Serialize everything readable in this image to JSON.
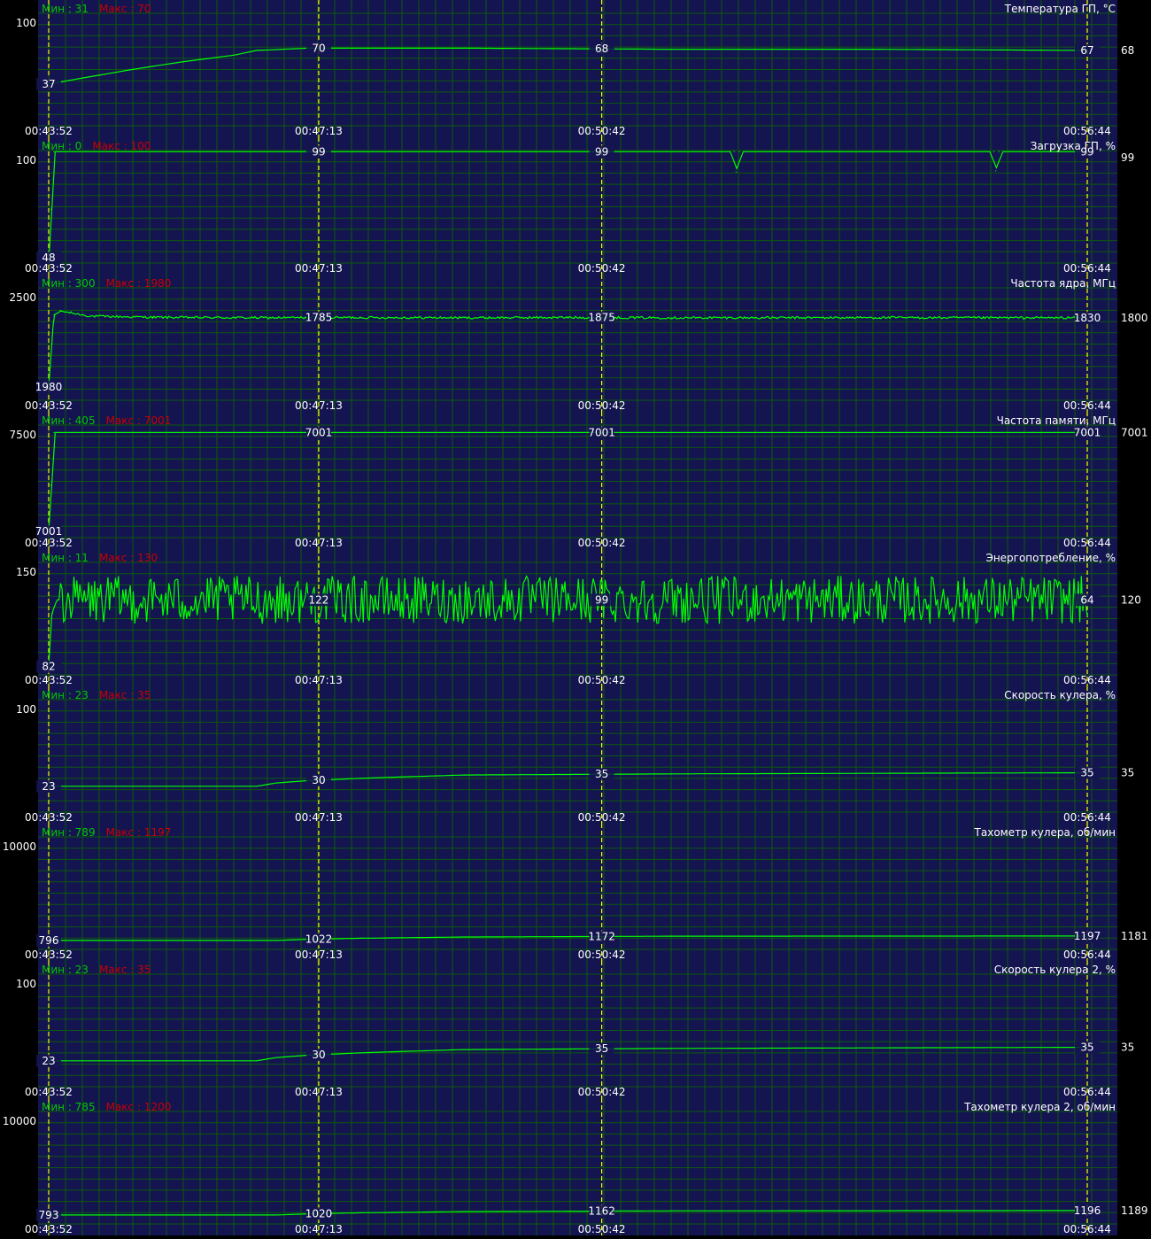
{
  "labels": {
    "min_prefix": "Мин : ",
    "max_prefix": "Макс : "
  },
  "colors": {
    "background": "#000000",
    "plot_bg": "#141450",
    "grid": "#0c5a0c",
    "line": "#00ff00",
    "marker": "#ffff00",
    "min_text": "#00c800",
    "max_text": "#c80000",
    "text": "#ffffff"
  },
  "chart_data": [
    {
      "type": "line",
      "title": "Температура ГП, °C",
      "ymax_label": "100",
      "ylim": [
        0,
        100
      ],
      "min_label": "31",
      "max_label": "70",
      "current": "68",
      "x_ticks": [
        "00:43:52",
        "00:47:13",
        "00:50:42",
        "00:56:44"
      ],
      "marker_values": [
        "37",
        "70",
        "68",
        "67"
      ],
      "x": [
        0,
        0.03,
        0.08,
        0.13,
        0.18,
        0.2,
        0.25,
        0.4,
        0.6,
        0.8,
        1
      ],
      "y": [
        37,
        42,
        50,
        57,
        63,
        67,
        69,
        69,
        68,
        68,
        67
      ]
    },
    {
      "type": "line",
      "title": "Загрузка ГП, %",
      "ymax_label": "100",
      "ylim": [
        0,
        100
      ],
      "min_label": "0",
      "max_label": "100",
      "current": "99",
      "x_ticks": [
        "00:43:52",
        "00:47:13",
        "00:50:42",
        "00:56:44"
      ],
      "marker_values": [
        "48",
        "99",
        "99",
        "99"
      ],
      "x": [
        0,
        0.002,
        0.005,
        0.66,
        0.662,
        0.665,
        0.91,
        0.912,
        0.915,
        1
      ],
      "y": [
        0,
        48,
        99,
        99,
        81,
        99,
        99,
        82,
        99,
        99
      ]
    },
    {
      "type": "line",
      "title": "Частота ядра, МГц",
      "ymax_label": "2500",
      "ylim": [
        0,
        2500
      ],
      "min_label": "300",
      "max_label": "1980",
      "current": "1800",
      "x_ticks": [
        "00:43:52",
        "00:47:13",
        "00:50:42",
        "00:56:44"
      ],
      "marker_values": [
        "1980",
        "1785",
        "1875",
        "1830"
      ],
      "x": [
        0,
        0.005,
        0.012,
        0.04,
        0.1,
        0.2,
        0.3,
        0.4,
        0.5,
        0.6,
        0.7,
        0.8,
        0.9,
        1
      ],
      "y": [
        300,
        1900,
        1980,
        1870,
        1845,
        1835,
        1840,
        1835,
        1840,
        1835,
        1835,
        1838,
        1835,
        1835
      ],
      "noise": 25
    },
    {
      "type": "line",
      "title": "Частота памяти, МГц",
      "ymax_label": "7500",
      "ylim": [
        0,
        7500
      ],
      "min_label": "405",
      "max_label": "7001",
      "current": "7001",
      "x_ticks": [
        "00:43:52",
        "00:47:13",
        "00:50:42",
        "00:56:44"
      ],
      "marker_values": [
        "7001",
        "7001",
        "7001",
        "7001"
      ],
      "x": [
        0,
        0.002,
        0.005,
        1
      ],
      "y": [
        405,
        3500,
        7001,
        7001
      ]
    },
    {
      "type": "line",
      "title": "Энергопотребление, %",
      "ymax_label": "150",
      "ylim": [
        0,
        150
      ],
      "min_label": "11",
      "max_label": "130",
      "current": "120",
      "x_ticks": [
        "00:43:52",
        "00:47:13",
        "00:50:42",
        "00:56:44"
      ],
      "marker_values": [
        "82",
        "122",
        "99",
        "64"
      ],
      "x": [
        0,
        0.003,
        0.008,
        1
      ],
      "y": [
        11,
        82,
        100,
        100
      ],
      "noise": 32
    },
    {
      "type": "line",
      "title": "Скорость кулера, %",
      "ymax_label": "100",
      "ylim": [
        0,
        100
      ],
      "min_label": "23",
      "max_label": "35",
      "current": "35",
      "x_ticks": [
        "00:43:52",
        "00:47:13",
        "00:50:42",
        "00:56:44"
      ],
      "marker_values": [
        "23",
        "30",
        "35",
        "35"
      ],
      "x": [
        0,
        0.2,
        0.22,
        0.25,
        0.3,
        0.33,
        0.4,
        0.6,
        1
      ],
      "y": [
        23,
        23,
        26,
        28,
        30,
        31,
        33,
        34,
        35
      ]
    },
    {
      "type": "line",
      "title": "Тахометр кулера, об/мин",
      "ymax_label": "10000",
      "ylim": [
        0,
        10000
      ],
      "min_label": "789",
      "max_label": "1197",
      "current": "1181",
      "x_ticks": [
        "00:43:52",
        "00:47:13",
        "00:50:42",
        "00:56:44"
      ],
      "marker_values": [
        "796",
        "1022",
        "1172",
        "1197"
      ],
      "x": [
        0,
        0.22,
        0.25,
        0.3,
        0.33,
        0.4,
        0.6,
        1
      ],
      "y": [
        796,
        796,
        900,
        990,
        1022,
        1100,
        1172,
        1190
      ]
    },
    {
      "type": "line",
      "title": "Скорость кулера 2, %",
      "ymax_label": "100",
      "ylim": [
        0,
        100
      ],
      "min_label": "23",
      "max_label": "35",
      "current": "35",
      "x_ticks": [
        "00:43:52",
        "00:47:13",
        "00:50:42",
        "00:56:44"
      ],
      "marker_values": [
        "23",
        "30",
        "35",
        "35"
      ],
      "x": [
        0,
        0.2,
        0.22,
        0.25,
        0.3,
        0.33,
        0.4,
        0.6,
        1
      ],
      "y": [
        23,
        23,
        26,
        28,
        30,
        31,
        33,
        34,
        35
      ]
    },
    {
      "type": "line",
      "title": "Тахометр кулера 2, об/мин",
      "ymax_label": "10000",
      "ylim": [
        0,
        10000
      ],
      "min_label": "785",
      "max_label": "1200",
      "current": "1189",
      "x_ticks": [
        "00:43:52",
        "00:47:13",
        "00:50:42",
        "00:56:44"
      ],
      "marker_values": [
        "793",
        "1020",
        "1162",
        "1196"
      ],
      "x": [
        0,
        0.22,
        0.25,
        0.3,
        0.33,
        0.4,
        0.6,
        1
      ],
      "y": [
        793,
        793,
        900,
        990,
        1020,
        1100,
        1162,
        1190
      ]
    }
  ]
}
